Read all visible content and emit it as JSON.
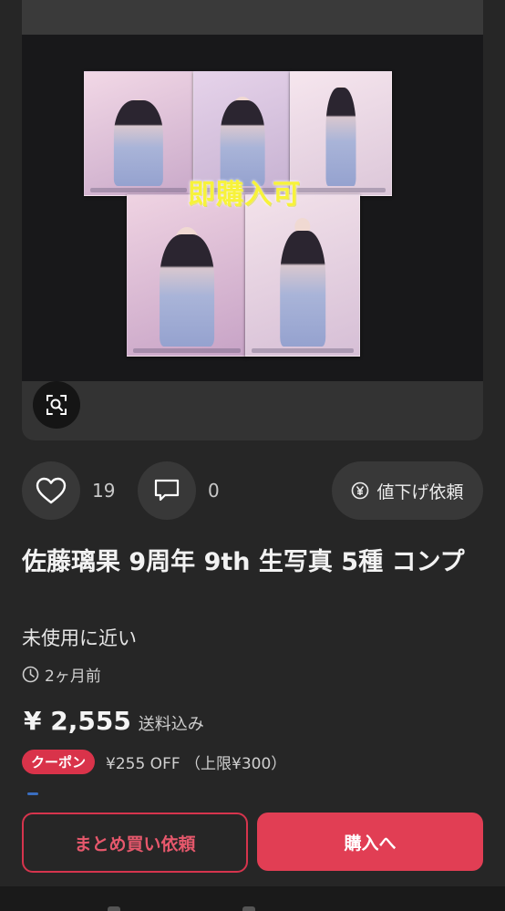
{
  "image": {
    "overlay_text": "即購入可"
  },
  "actions": {
    "like_count": "19",
    "comment_count": "0",
    "price_down_label": "値下げ依頼"
  },
  "item": {
    "title": "佐藤璃果 9周年 9th 生写真 5種 コンプ",
    "condition": "未使用に近い",
    "posted_ago": "2ヶ月前",
    "price": "¥ 2,555",
    "shipping_note": "送料込み"
  },
  "coupon": {
    "badge": "クーポン",
    "text": "¥255 OFF （上限¥300）"
  },
  "buttons": {
    "bulk_request": "まとめ買い依頼",
    "purchase": "購入へ"
  },
  "colors": {
    "accent": "#e13e54",
    "background": "#262626",
    "overlay_yellow": "#f7f23b"
  }
}
